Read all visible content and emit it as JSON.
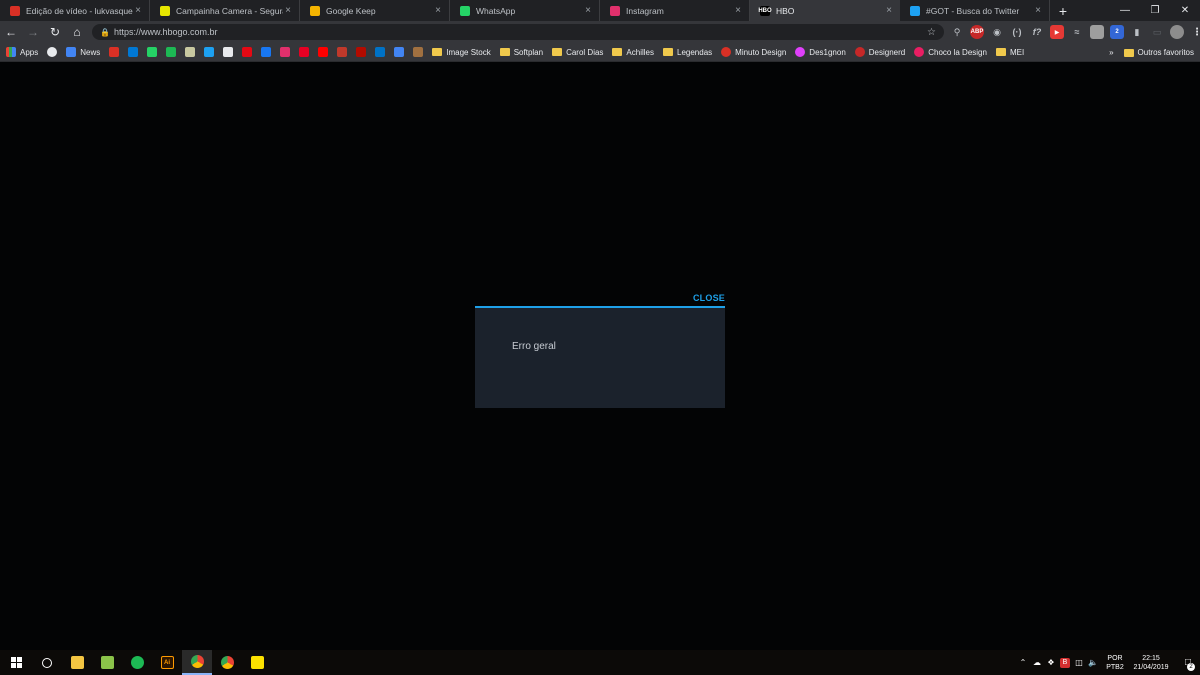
{
  "tabs": [
    {
      "title": "Edição de vídeo - lukvasques@gi",
      "favicon_color": "#d93025",
      "icon": "gmail-icon"
    },
    {
      "title": "Campainha Camera - Segurança",
      "favicon_color": "#e6e600",
      "icon": "yellow-oval-icon"
    },
    {
      "title": "Google Keep",
      "favicon_color": "#f4b400",
      "icon": "keep-icon"
    },
    {
      "title": "WhatsApp",
      "favicon_color": "#25d366",
      "icon": "whatsapp-icon"
    },
    {
      "title": "Instagram",
      "favicon_color": "#e1306c",
      "icon": "instagram-icon"
    },
    {
      "title": "HBO",
      "favicon_color": "#000000",
      "icon": "hbo-icon",
      "favicon_text": "HBO",
      "active": true
    },
    {
      "title": "#GOT - Busca do Twitter",
      "favicon_color": "#1da1f2",
      "icon": "twitter-icon"
    }
  ],
  "toolbar": {
    "url": "https://www.hbogo.com.br"
  },
  "bookmarks": {
    "apps_label": "Apps",
    "news_label": "News",
    "icon_only": [
      {
        "icon": "gmail-icon",
        "color": "#d93025"
      },
      {
        "icon": "outlook-icon",
        "color": "#0078d4"
      },
      {
        "icon": "whatsapp-icon",
        "color": "#25d366"
      },
      {
        "icon": "spotify-icon",
        "color": "#1db954"
      },
      {
        "icon": "oval-icon",
        "color": "#c8c8a0"
      },
      {
        "icon": "twitter-icon",
        "color": "#1da1f2"
      },
      {
        "icon": "google-icon",
        "color": "#e8eaed"
      },
      {
        "icon": "netflix-icon",
        "color": "#e50914"
      },
      {
        "icon": "facebook-icon",
        "color": "#1877f2"
      },
      {
        "icon": "instagram-icon",
        "color": "#e1306c"
      },
      {
        "icon": "pinterest-icon",
        "color": "#e60023"
      },
      {
        "icon": "youtube-icon",
        "color": "#ff0000"
      },
      {
        "icon": "square-red-icon",
        "color": "#c0392b"
      },
      {
        "icon": "acrobat-icon",
        "color": "#b30b00"
      },
      {
        "icon": "outlook-mail-icon",
        "color": "#0072c6"
      },
      {
        "icon": "inbox-icon",
        "color": "#4285f4"
      },
      {
        "icon": "avatar-icon",
        "color": "#a07040"
      }
    ],
    "labeled": [
      {
        "label": "Image Stock",
        "kind": "folder"
      },
      {
        "label": "Softplan",
        "kind": "folder"
      },
      {
        "label": "Carol Dias",
        "kind": "folder"
      },
      {
        "label": "Achilles",
        "kind": "folder"
      },
      {
        "label": "Legendas",
        "kind": "folder"
      },
      {
        "label": "Minuto Design",
        "kind": "site",
        "color": "#d93025"
      },
      {
        "label": "Des1gnon",
        "kind": "site",
        "color": "#e040fb"
      },
      {
        "label": "Designerd",
        "kind": "site",
        "color": "#c62828"
      },
      {
        "label": "Choco la Design",
        "kind": "site",
        "color": "#e91e63"
      },
      {
        "label": "MEI",
        "kind": "folder"
      }
    ],
    "more_label": "»",
    "other_label": "Outros favoritos"
  },
  "modal": {
    "close_label": "CLOSE",
    "message": "Erro geral",
    "accent": "#1ea0e8"
  },
  "taskbar": {
    "lang_line1": "POR",
    "lang_line2": "PTB2",
    "time": "22:15",
    "date": "21/04/2019",
    "notification_count": "2"
  }
}
